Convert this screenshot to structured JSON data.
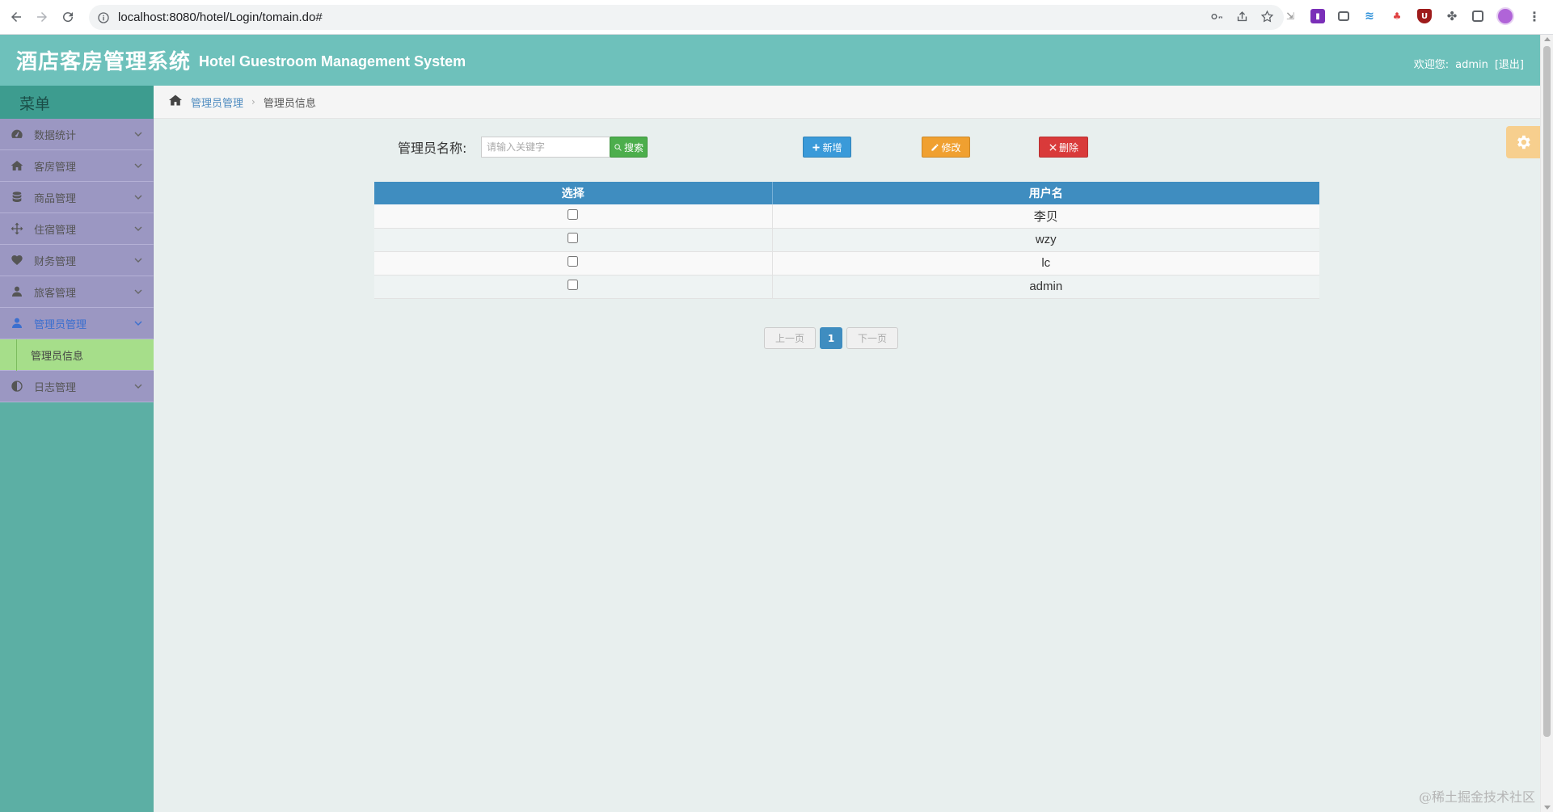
{
  "browser": {
    "url": "localhost:8080/hotel/Login/tomain.do#"
  },
  "header": {
    "title": "酒店客房管理系统",
    "subtitle": "Hotel Guestroom Management System",
    "welcome_label": "欢迎您:",
    "username": "admin",
    "logout": "[退出]"
  },
  "sidebar": {
    "menu_title": "菜单",
    "items": [
      {
        "label": "数据统计",
        "icon": "dashboard-icon"
      },
      {
        "label": "客房管理",
        "icon": "home-icon"
      },
      {
        "label": "商品管理",
        "icon": "database-icon"
      },
      {
        "label": "住宿管理",
        "icon": "move-icon"
      },
      {
        "label": "财务管理",
        "icon": "heart-icon"
      },
      {
        "label": "旅客管理",
        "icon": "user-icon"
      },
      {
        "label": "管理员管理",
        "icon": "user-icon"
      },
      {
        "label": "日志管理",
        "icon": "adjust-icon"
      }
    ],
    "active_item": "管理员管理",
    "submenu": [
      {
        "label": "管理员信息"
      }
    ]
  },
  "breadcrumb": {
    "parent": "管理员管理",
    "current": "管理员信息"
  },
  "toolbar": {
    "search_label": "管理员名称:",
    "search_placeholder": "请输入关键字",
    "search_button": "搜索",
    "add_button": "新增",
    "edit_button": "修改",
    "delete_button": "删除"
  },
  "table": {
    "columns": [
      "选择",
      "用户名"
    ],
    "rows": [
      {
        "username": "李贝",
        "checked": false
      },
      {
        "username": "wzy",
        "checked": false
      },
      {
        "username": "lc",
        "checked": false
      },
      {
        "username": "admin",
        "checked": false
      }
    ]
  },
  "pager": {
    "prev": "上一页",
    "current": "1",
    "next": "下一页"
  },
  "watermark": "@稀土掘金技术社区",
  "colors": {
    "header_bg": "#6ec1bb",
    "sidebar_bg": "#5cafa4",
    "menu_item_bg": "#9b97c2",
    "submenu_bg": "#a6de8a",
    "table_header_bg": "#3f8dc0"
  }
}
